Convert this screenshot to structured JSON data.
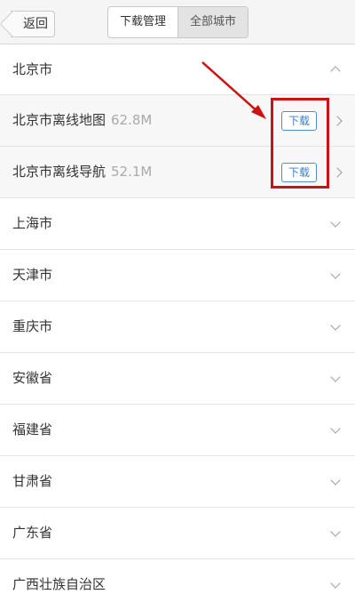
{
  "header": {
    "back_label": "返回",
    "tabs": [
      {
        "label": "下载管理",
        "active": false
      },
      {
        "label": "全部城市",
        "active": true
      }
    ]
  },
  "expanded": {
    "name": "北京市",
    "items": [
      {
        "name": "北京市离线地图",
        "size": "62.8M",
        "action": "下载"
      },
      {
        "name": "北京市离线导航",
        "size": "52.1M",
        "action": "下载"
      }
    ]
  },
  "cities": [
    "上海市",
    "天津市",
    "重庆市",
    "安徽省",
    "福建省",
    "甘肃省",
    "广东省",
    "广西壮族自治区"
  ],
  "colors": {
    "highlight": "#cc1111",
    "accent": "#3a7fc8"
  }
}
